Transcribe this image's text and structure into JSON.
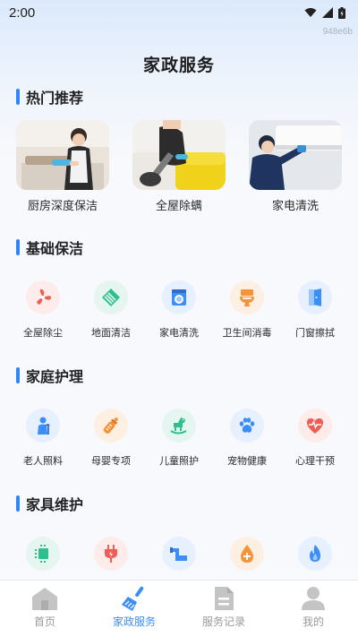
{
  "status_bar": {
    "time": "2:00"
  },
  "watermark": "948e6b",
  "page_title": "家政服务",
  "sections": {
    "hot": {
      "title": "热门推荐"
    },
    "basic": {
      "title": "基础保洁"
    },
    "family": {
      "title": "家庭护理"
    },
    "appliance": {
      "title": "家具维护"
    }
  },
  "hot_items": [
    {
      "label": "厨房深度保洁",
      "icon": "kitchen-cleaning-photo"
    },
    {
      "label": "全屋除螨",
      "icon": "mite-removal-photo"
    },
    {
      "label": "家电清洗",
      "icon": "appliance-cleaning-photo"
    }
  ],
  "basic_items": [
    {
      "label": "全屋除尘",
      "icon": "fan-icon",
      "color": "#ef5d55"
    },
    {
      "label": "地面清洁",
      "icon": "floor-tile-icon",
      "color": "#2fbf8f"
    },
    {
      "label": "家电清洗",
      "icon": "washing-machine-icon",
      "color": "#3a8ef6"
    },
    {
      "label": "卫生间消毒",
      "icon": "toilet-icon",
      "color": "#f5933a"
    },
    {
      "label": "门窗擦拭",
      "icon": "door-icon",
      "color": "#3a8ef6"
    }
  ],
  "family_items": [
    {
      "label": "老人照料",
      "icon": "elderly-icon",
      "color": "#3a8ef6"
    },
    {
      "label": "母婴专项",
      "icon": "baby-bottle-icon",
      "color": "#f5933a"
    },
    {
      "label": "儿童照护",
      "icon": "rocking-horse-icon",
      "color": "#2fbf8f"
    },
    {
      "label": "宠物健康",
      "icon": "paw-icon",
      "color": "#3a8ef6"
    },
    {
      "label": "心理干预",
      "icon": "heartbeat-icon",
      "color": "#ef5d55"
    }
  ],
  "appliance_items": [
    {
      "icon": "circuit-board-icon",
      "color": "#2fbf8f"
    },
    {
      "icon": "plug-icon",
      "color": "#ef5d55"
    },
    {
      "icon": "pipe-icon",
      "color": "#3a8ef6"
    },
    {
      "icon": "water-drop-plus-icon",
      "color": "#f5933a"
    },
    {
      "icon": "flame-icon",
      "color": "#3a8ef6"
    }
  ],
  "tabs": [
    {
      "label": "首页",
      "icon": "home-icon",
      "active": false
    },
    {
      "label": "家政服务",
      "icon": "broom-icon",
      "active": true
    },
    {
      "label": "服务记录",
      "icon": "document-icon",
      "active": false
    },
    {
      "label": "我的",
      "icon": "user-icon",
      "active": false
    }
  ],
  "colors": {
    "accent": "#3a8ef6",
    "section_bar": "#2f86f6",
    "tab_inactive": "#9a9a9a"
  }
}
